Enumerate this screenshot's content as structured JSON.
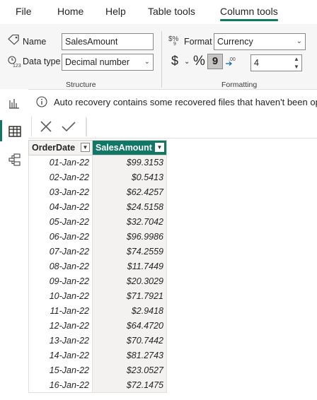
{
  "tabs": [
    {
      "label": "File"
    },
    {
      "label": "Home"
    },
    {
      "label": "Help"
    },
    {
      "label": "Table tools"
    },
    {
      "label": "Column tools"
    }
  ],
  "active_tab": "Column tools",
  "structure": {
    "name_label": "Name",
    "name_value": "SalesAmount",
    "datatype_label": "Data type",
    "datatype_value": "Decimal number",
    "group_title": "Structure"
  },
  "formatting": {
    "format_label": "Format",
    "format_value": "Currency",
    "currency_symbol": "$",
    "percent_symbol": "%",
    "comma_symbol": "9",
    "decimal_icon_text": ".00",
    "decimals_value": "4",
    "group_title": "Formatting"
  },
  "infobar": {
    "message": "Auto recovery contains some recovered files that haven't been opened."
  },
  "table": {
    "columns": [
      "OrderDate",
      "SalesAmount"
    ],
    "rows": [
      [
        "01-Jan-22",
        "$99.3153"
      ],
      [
        "02-Jan-22",
        "$0.5413"
      ],
      [
        "03-Jan-22",
        "$62.4257"
      ],
      [
        "04-Jan-22",
        "$24.5158"
      ],
      [
        "05-Jan-22",
        "$32.7042"
      ],
      [
        "06-Jan-22",
        "$96.9986"
      ],
      [
        "07-Jan-22",
        "$74.2559"
      ],
      [
        "08-Jan-22",
        "$11.7449"
      ],
      [
        "09-Jan-22",
        "$20.3029"
      ],
      [
        "10-Jan-22",
        "$71.7921"
      ],
      [
        "11-Jan-22",
        "$2.9418"
      ],
      [
        "12-Jan-22",
        "$64.4720"
      ],
      [
        "13-Jan-22",
        "$70.7442"
      ],
      [
        "14-Jan-22",
        "$81.2743"
      ],
      [
        "15-Jan-22",
        "$23.0527"
      ],
      [
        "16-Jan-22",
        "$72.1475"
      ]
    ]
  },
  "colors": {
    "accent": "#117865",
    "ribbon_bg": "#f6f6f6"
  }
}
